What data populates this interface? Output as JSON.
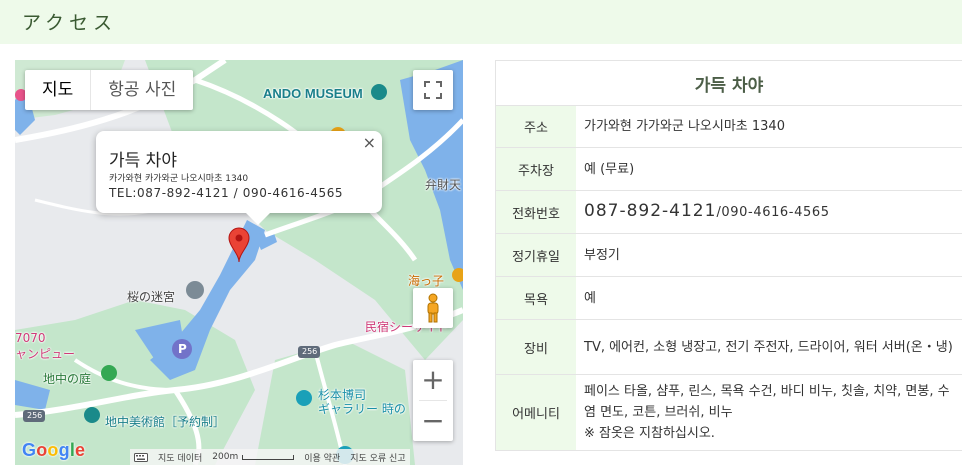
{
  "header": {
    "title": "アクセス"
  },
  "map": {
    "type_buttons": [
      "지도",
      "항공 사진"
    ],
    "info_window": {
      "name": "가득 차야",
      "address": "카가와현 카가와군 나오시마초 1340",
      "tel": "TEL:087-892-4121  /  090-4616-4565",
      "close": "×"
    },
    "labels": {
      "ando_museum": "ANDO MUSEUM",
      "benzaiten": "弁財天",
      "umiko": "海っ子",
      "sakura_meikyu": "桜の迷宮",
      "minshuku": "民宿シーサイド",
      "jichu_garden": "地中の庭",
      "jichu_museum": "地中美術館［予約制］",
      "sugimoto": "杉本博司",
      "sugimoto_gallery": "ギャラリー 時の",
      "n7070": "7070",
      "panview": "ャンピュー",
      "road_256": "256",
      "parking": "P"
    },
    "google": "Google",
    "footer": {
      "data": "지도 데이터",
      "scale": "200m",
      "terms": "이용 약관",
      "report": "지도 오류 신고"
    },
    "zoom_in": "+",
    "zoom_out": "−",
    "icons": [
      "fullscreen-icon",
      "pegman-icon",
      "map-pin-icon",
      "keyboard-icon"
    ]
  },
  "info": {
    "title": "가득 차야",
    "rows": [
      {
        "label": "주소",
        "value": "가가와현 가가와군 나오시마초 1340"
      },
      {
        "label": "주차장",
        "value": "예 (무료)"
      },
      {
        "label": "전화번호",
        "tel_main": "087-892-4121",
        "tel_sub": " /090-4616-4565"
      },
      {
        "label": "정기휴일",
        "value": "부정기"
      },
      {
        "label": "목욕",
        "value": "예"
      },
      {
        "label": "장비",
        "value": "TV, 에어컨, 소형 냉장고, 전기 주전자, 드라이어, 워터 서버(온・냉)"
      },
      {
        "label": "어메니티",
        "value": "페이스 타올, 샴푸, 린스, 목욕 수건, 바디 비누, 칫솔, 치약, 면봉, 수염 면도, 코튼, 브러쉬, 비누",
        "note": "※ 잠옷은 지참하십시오."
      }
    ]
  },
  "colors": {
    "header_bg": "#eefaea",
    "water": "#7fb2ea",
    "green": "#c6e8cc",
    "pin": "#ea4335"
  }
}
